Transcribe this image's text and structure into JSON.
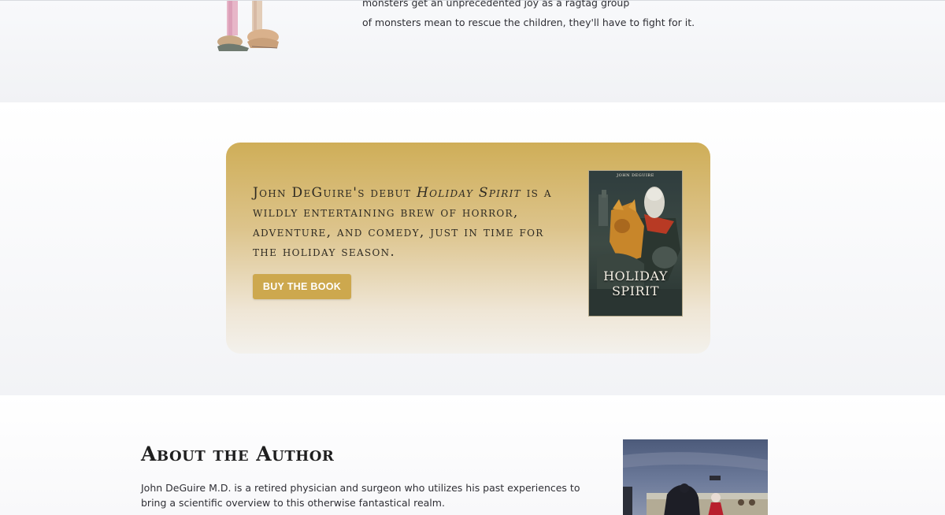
{
  "story_section": {
    "text_line_1": "monsters get an unprecedented joy as a ragtag group",
    "text_line_2": "of monsters mean to rescue the children, they'll have to fight for it."
  },
  "promo": {
    "text_part_1": "John DeGuire's debut ",
    "book_title_italic": "Holiday Spirit",
    "text_part_2": " is a wildly entertaining brew of horror, adventure, and comedy, just in time for the holiday season.",
    "buy_button_label": "BUY THE BOOK",
    "cover": {
      "author": "JOHN DEGUIRE",
      "title_line_1": "HOLIDAY",
      "title_line_2": "SPIRIT"
    }
  },
  "author": {
    "heading": "About the Author",
    "bio": "John DeGuire M.D. is a retired physician and surgeon who utilizes his past experiences to bring a scientific overview to this otherwise fantastical realm."
  },
  "colors": {
    "accent_gold": "#cda84e",
    "card_gradient_top": "#cfae58",
    "card_gradient_bottom": "#f3f1ec"
  }
}
